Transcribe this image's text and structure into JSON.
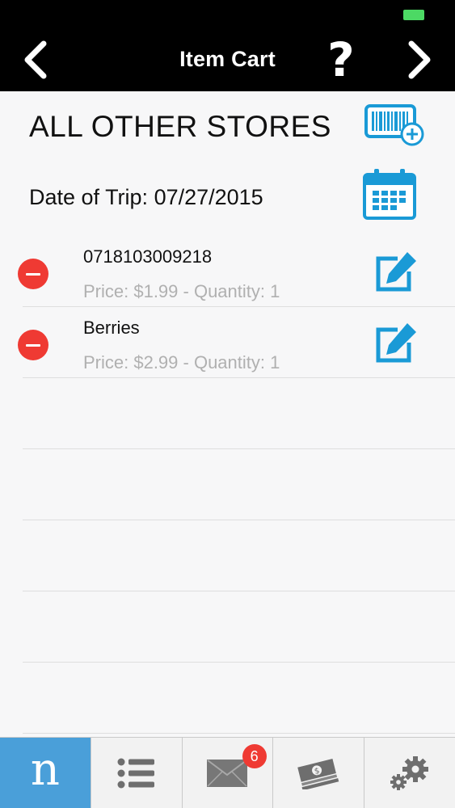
{
  "header": {
    "title": "Item Cart",
    "back_icon": "chevron-left-icon",
    "help_label": "?",
    "forward_icon": "chevron-right-icon"
  },
  "store": {
    "name": "ALL OTHER STORES",
    "add_barcode_icon": "barcode-add-icon"
  },
  "trip": {
    "date_text": "Date of Trip: 07/27/2015",
    "calendar_icon": "calendar-icon"
  },
  "items": [
    {
      "name": "0718103009218",
      "detail": "Price: $1.99 - Quantity: 1"
    },
    {
      "name": "Berries",
      "detail": "Price: $2.99 - Quantity: 1"
    }
  ],
  "tabs": [
    {
      "id": "home",
      "icon": "app-logo-icon",
      "label": "n"
    },
    {
      "id": "list",
      "icon": "list-icon"
    },
    {
      "id": "messages",
      "icon": "envelope-icon",
      "badge": "6"
    },
    {
      "id": "rewards",
      "icon": "money-icon"
    },
    {
      "id": "settings",
      "icon": "gears-icon"
    }
  ],
  "colors": {
    "accent": "#1a9ad6",
    "remove": "#ef3a33",
    "header_bg": "#000000",
    "home_tab": "#4a9fd9"
  }
}
